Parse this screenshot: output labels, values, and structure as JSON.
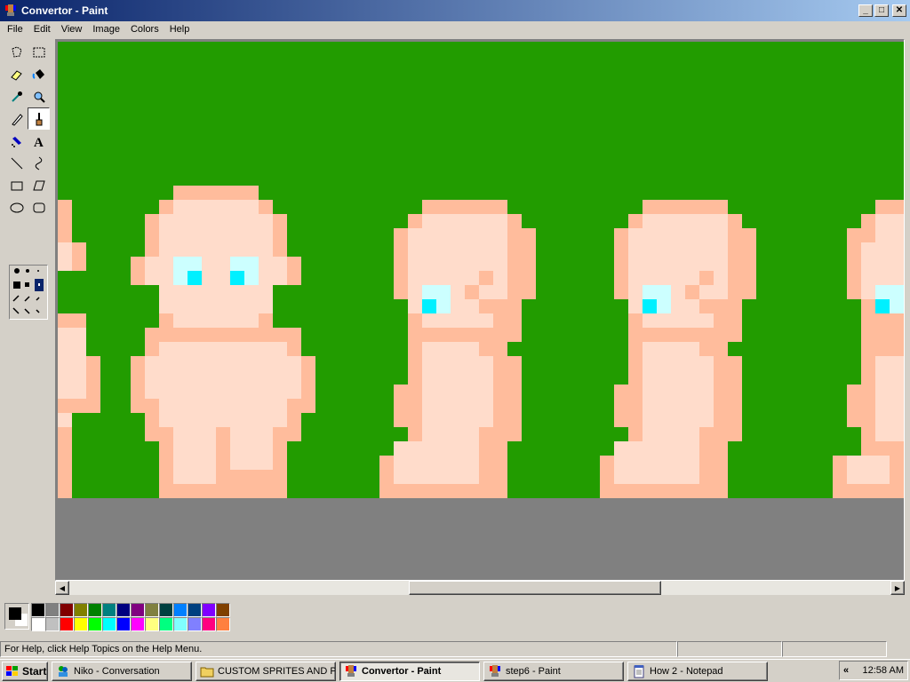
{
  "window": {
    "title": "Convertor - Paint"
  },
  "menu": [
    "File",
    "Edit",
    "View",
    "Image",
    "Colors",
    "Help"
  ],
  "tools": [
    {
      "name": "free-form-select-icon",
      "active": false
    },
    {
      "name": "rect-select-icon",
      "active": false
    },
    {
      "name": "eraser-icon",
      "active": false
    },
    {
      "name": "fill-bucket-icon",
      "active": false
    },
    {
      "name": "color-picker-icon",
      "active": false
    },
    {
      "name": "magnifier-icon",
      "active": false
    },
    {
      "name": "pencil-icon",
      "active": false
    },
    {
      "name": "brush-icon",
      "active": true
    },
    {
      "name": "airbrush-icon",
      "active": false
    },
    {
      "name": "text-icon",
      "active": false
    },
    {
      "name": "line-icon",
      "active": false
    },
    {
      "name": "curve-icon",
      "active": false
    },
    {
      "name": "rectangle-icon",
      "active": false
    },
    {
      "name": "polygon-icon",
      "active": false
    },
    {
      "name": "ellipse-icon",
      "active": false
    },
    {
      "name": "rounded-rect-icon",
      "active": false
    }
  ],
  "colors": {
    "canvas_bg": "#229c00",
    "skin_light": "#ffdccb",
    "skin_dark": "#ffbc9c",
    "eye": "#00f0ff",
    "eye_highlight": "#ccffff",
    "foreground": "#000000",
    "background": "#ffffff"
  },
  "palette": [
    "#000000",
    "#808080",
    "#800000",
    "#808000",
    "#008000",
    "#008080",
    "#000080",
    "#800080",
    "#808040",
    "#004040",
    "#0080ff",
    "#004080",
    "#8000ff",
    "#804000",
    "#ffffff",
    "#c0c0c0",
    "#ff0000",
    "#ffff00",
    "#00ff00",
    "#00ffff",
    "#0000ff",
    "#ff00ff",
    "#ffff80",
    "#00ff80",
    "#80ffff",
    "#8080ff",
    "#ff0080",
    "#ff8040"
  ],
  "status": {
    "help": "For Help, click Help Topics on the Help Menu."
  },
  "taskbar": {
    "start": "Start",
    "tasks": [
      {
        "label": "Niko - Conversation",
        "icon": "messenger-icon",
        "active": false
      },
      {
        "label": "CUSTOM SPRITES AND P...",
        "icon": "folder-icon",
        "active": false
      },
      {
        "label": "Convertor - Paint",
        "icon": "paint-icon",
        "active": true
      },
      {
        "label": "step6 - Paint",
        "icon": "paint-icon",
        "active": false
      },
      {
        "label": "How 2 - Notepad",
        "icon": "notepad-icon",
        "active": false
      }
    ],
    "tray_arrow": "«",
    "clock": "12:58 AM"
  }
}
